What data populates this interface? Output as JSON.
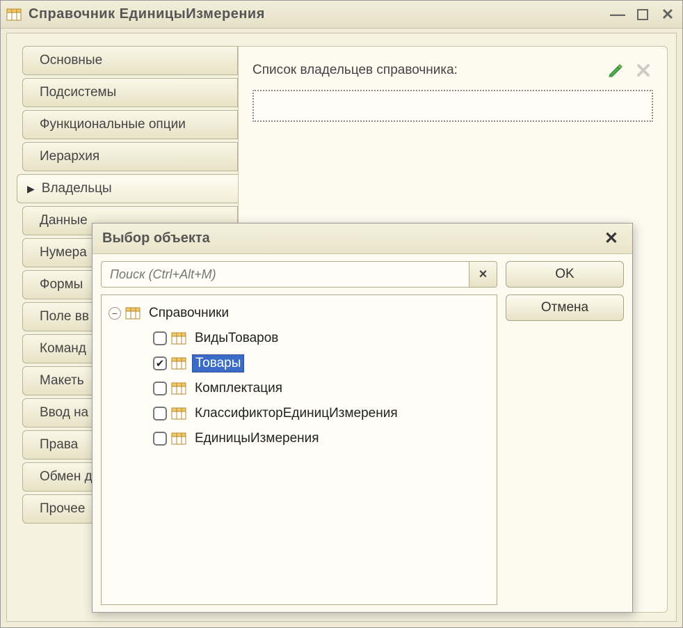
{
  "window": {
    "title": "Справочник ЕдиницыИзмерения"
  },
  "nav": {
    "items": [
      {
        "label": "Основные"
      },
      {
        "label": "Подсистемы"
      },
      {
        "label": "Функциональные опции"
      },
      {
        "label": "Иерархия"
      },
      {
        "label": "Владельцы",
        "active": true
      },
      {
        "label": "Данные"
      },
      {
        "label": "Нумера"
      },
      {
        "label": "Формы"
      },
      {
        "label": "Поле вв"
      },
      {
        "label": "Команд"
      },
      {
        "label": "Макеть"
      },
      {
        "label": "Ввод на"
      },
      {
        "label": "Права"
      },
      {
        "label": "Обмен д"
      },
      {
        "label": "Прочее"
      }
    ]
  },
  "panel": {
    "owners_label": "Список владельцев справочника:"
  },
  "dialog": {
    "title": "Выбор объекта",
    "search_placeholder": "Поиск (Ctrl+Alt+M)",
    "ok_label": "OK",
    "cancel_label": "Отмена",
    "tree": {
      "root": "Справочники",
      "items": [
        {
          "label": "ВидыТоваров",
          "checked": false
        },
        {
          "label": "Товары",
          "checked": true,
          "selected": true
        },
        {
          "label": "Комплектация",
          "checked": false
        },
        {
          "label": "КлассификторЕдиницИзмерения",
          "checked": false
        },
        {
          "label": "ЕдиницыИзмерения",
          "checked": false
        }
      ]
    }
  }
}
